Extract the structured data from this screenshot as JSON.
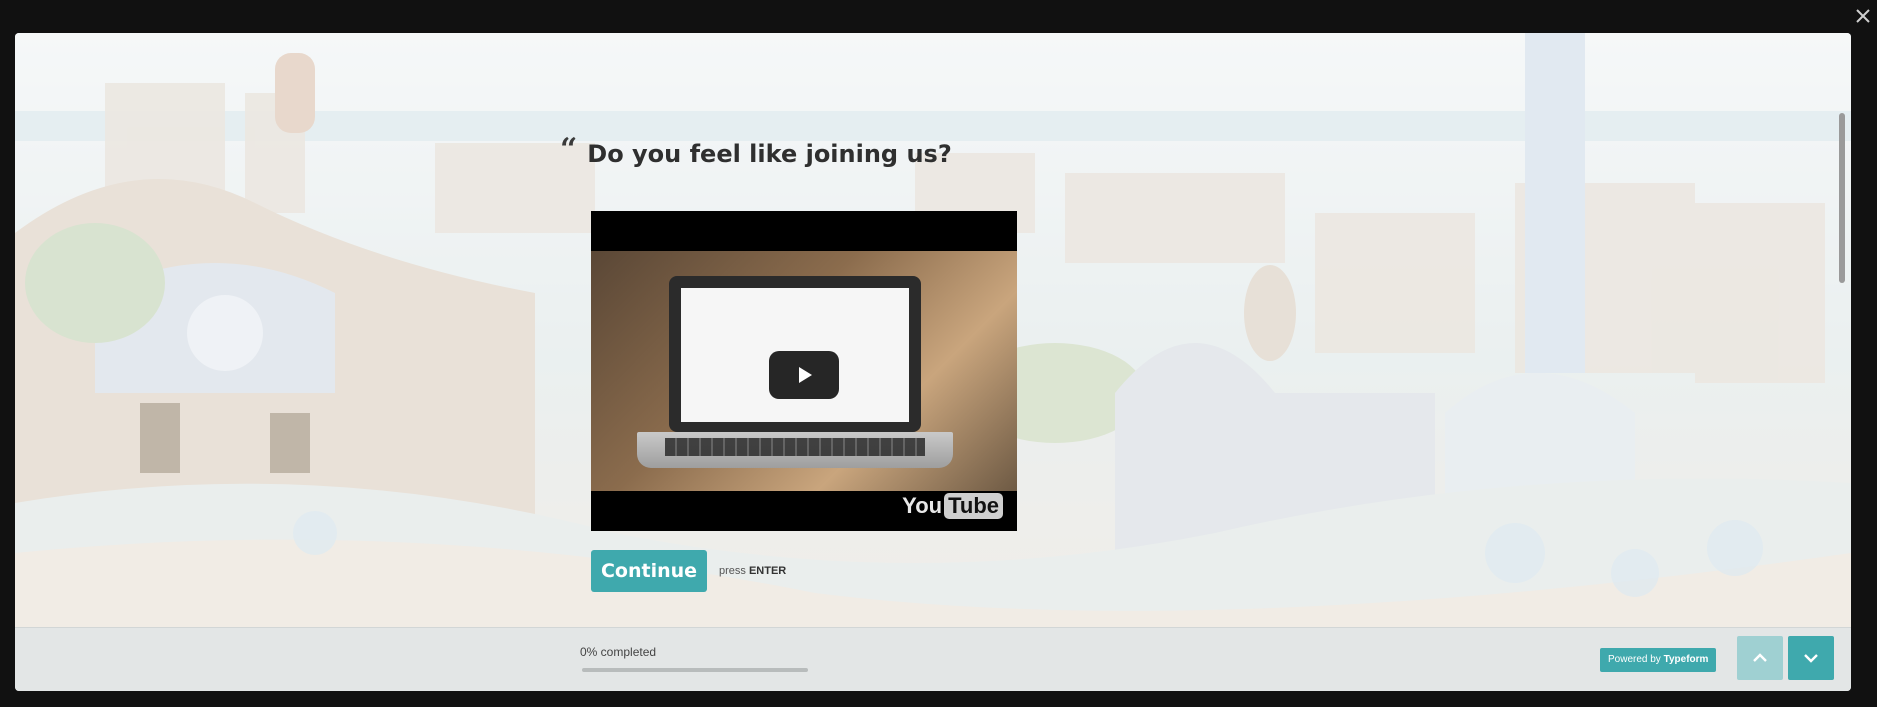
{
  "question": {
    "quote_mark": "“",
    "text": "Do you feel like joining us?"
  },
  "video": {
    "logo_you": "You",
    "logo_tube": "Tube"
  },
  "actions": {
    "continue_label": "Continue",
    "press_prefix": "press",
    "press_key": "ENTER"
  },
  "footer": {
    "progress_text": "0% completed",
    "progress_fraction": 0,
    "powered_prefix": "Powered by",
    "powered_brand": "Typeform"
  },
  "colors": {
    "accent": "#3fa9ad",
    "accent_light": "#9fd0d2"
  },
  "icons": {
    "close": "close-icon",
    "up": "chevron-up-icon",
    "down": "chevron-down-icon",
    "play": "play-icon"
  }
}
